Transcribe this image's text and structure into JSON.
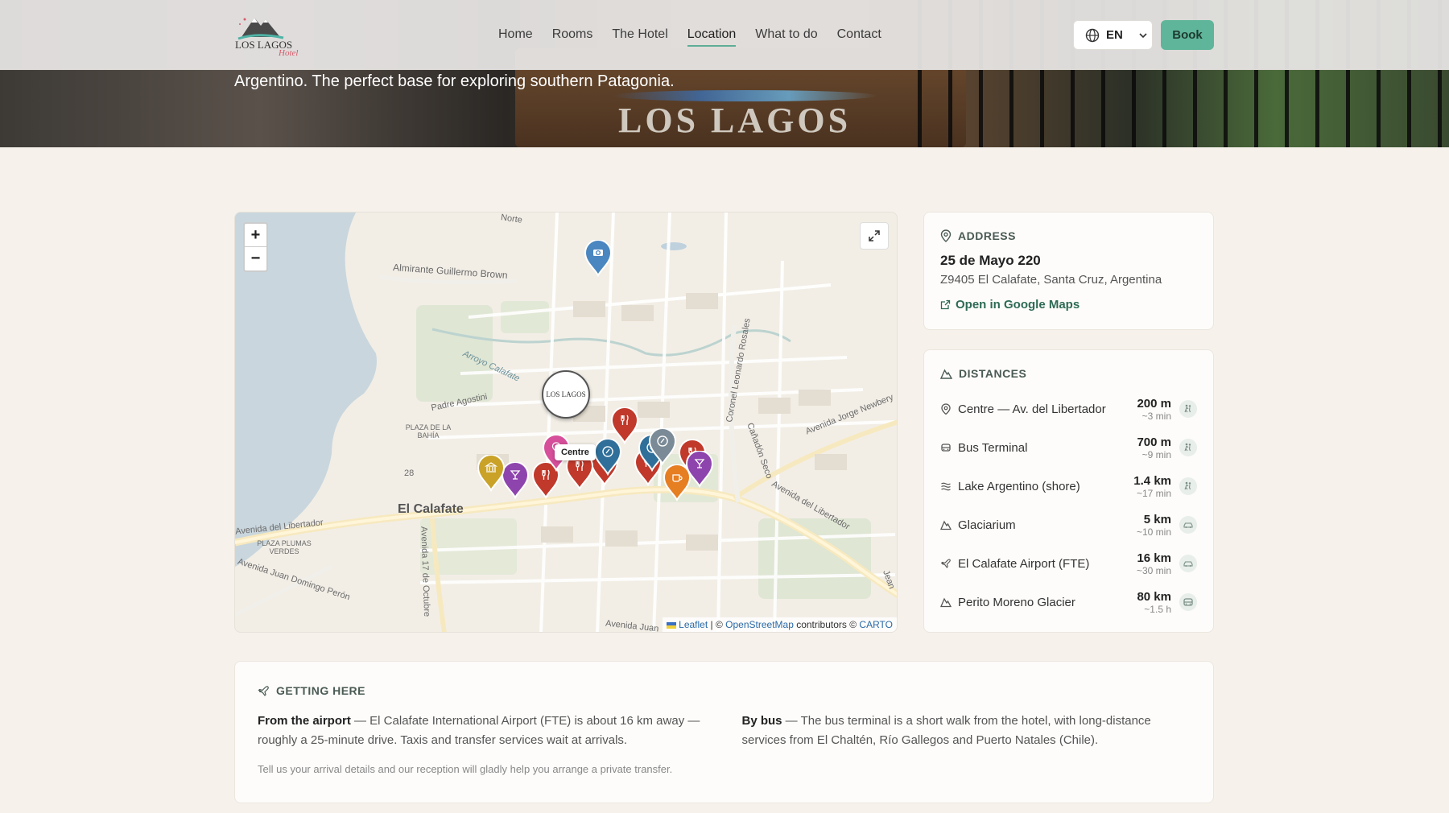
{
  "header": {
    "nav": [
      {
        "label": "Home",
        "active": false
      },
      {
        "label": "Rooms",
        "active": false
      },
      {
        "label": "The Hotel",
        "active": false
      },
      {
        "label": "Location",
        "active": true
      },
      {
        "label": "What to do",
        "active": false
      },
      {
        "label": "Contact",
        "active": false
      }
    ],
    "language": "EN",
    "book_label": "Book",
    "logo_text": "LOS LAGOS",
    "logo_script": "Hotel"
  },
  "hero": {
    "subtitle": "Argentino. The perfect base for exploring southern Patagonia.",
    "sign_text": "LOS LAGOS"
  },
  "map": {
    "zoom_in": "+",
    "zoom_out": "−",
    "city_label": "El Calafate",
    "tooltip": "Centre",
    "hotel_marker_text": "LOS LAGOS",
    "street_labels": [
      "Almirante Guillermo Brown",
      "Arroyo Calafate",
      "Padre Agostini",
      "Avenida del Libertador",
      "Avenida 17 de Octubre",
      "Coronel Leonardo Rosales",
      "Avenida Jorge Newbery",
      "Avenida Juan Domingo Perón",
      "Cañadón Seco",
      "Avenida Juan",
      "Norte",
      "Jean"
    ],
    "area_labels": [
      "PLAZA DE LA BAHÍA",
      "PLAZA PLUMAS VERDES",
      "28"
    ],
    "attribution": {
      "leaflet": "Leaflet",
      "sep": " | © ",
      "osm": "OpenStreetMap",
      "contributors": " contributors © ",
      "carto": "CARTO"
    },
    "markers": [
      {
        "type": "camera",
        "color": "#4a86c0"
      },
      {
        "type": "restaurant",
        "color": "#c0392b"
      },
      {
        "type": "restaurant",
        "color": "#c0392b"
      },
      {
        "type": "restaurant",
        "color": "#c0392b"
      },
      {
        "type": "restaurant",
        "color": "#c0392b"
      },
      {
        "type": "restaurant",
        "color": "#c0392b"
      },
      {
        "type": "restaurant",
        "color": "#c0392b"
      },
      {
        "type": "bar",
        "color": "#8e44ad"
      },
      {
        "type": "bar",
        "color": "#8e44ad"
      },
      {
        "type": "museum",
        "color": "#c9a227"
      },
      {
        "type": "cafe",
        "color": "#e67e22"
      },
      {
        "type": "centre",
        "color": "#d64f9a"
      },
      {
        "type": "info",
        "color": "#2f6f9a"
      },
      {
        "type": "info",
        "color": "#2f6f9a"
      },
      {
        "type": "info",
        "color": "#7a8a96"
      }
    ]
  },
  "address": {
    "title": "ADDRESS",
    "street": "25 de Mayo 220",
    "city": "Z9405 El Calafate, Santa Cruz, Argentina",
    "link": "Open in Google Maps"
  },
  "distances": {
    "title": "DISTANCES",
    "items": [
      {
        "icon": "pin-icon",
        "label": "Centre — Av. del Libertador",
        "distance": "200 m",
        "time": "~3 min",
        "mode": "walk-icon"
      },
      {
        "icon": "bus-icon",
        "label": "Bus Terminal",
        "distance": "700 m",
        "time": "~9 min",
        "mode": "walk-icon"
      },
      {
        "icon": "waves-icon",
        "label": "Lake Argentino (shore)",
        "distance": "1.4 km",
        "time": "~17 min",
        "mode": "walk-icon"
      },
      {
        "icon": "mountain-icon",
        "label": "Glaciarium",
        "distance": "5 km",
        "time": "~10 min",
        "mode": "car-icon"
      },
      {
        "icon": "plane-icon",
        "label": "El Calafate Airport (FTE)",
        "distance": "16 km",
        "time": "~30 min",
        "mode": "car-icon"
      },
      {
        "icon": "mountain-icon",
        "label": "Perito Moreno Glacier",
        "distance": "80 km",
        "time": "~1.5 h",
        "mode": "bus-icon"
      }
    ]
  },
  "getting_here": {
    "title": "GETTING HERE",
    "airport_label": "From the airport",
    "airport_text": " — El Calafate International Airport (FTE) is about 16 km away — roughly a 25-minute drive. Taxis and transfer services wait at arrivals.",
    "bus_label": "By bus",
    "bus_text": " — The bus terminal is a short walk from the hotel, with long-distance services from El Chaltén, Río Gallegos and Puerto Natales (Chile).",
    "note": "Tell us your arrival details and our reception will gladly help you arrange a private transfer."
  },
  "colors": {
    "accent": "#5fb59a",
    "link": "#2d6a55",
    "background": "#f6f2eb"
  }
}
